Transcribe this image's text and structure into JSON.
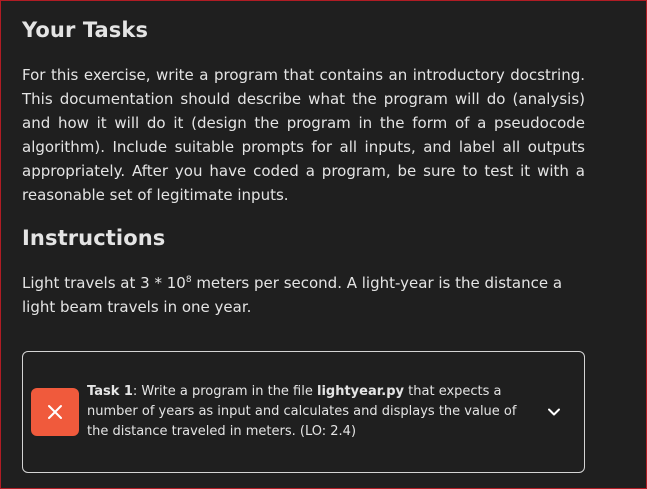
{
  "tasks_section": {
    "heading": "Your Tasks",
    "body": "For this exercise, write a program that contains an introductory docstring. This documentation should describe what the program will do (analysis) and how it will do it (design the program in the form of a pseudocode algorithm). Include suitable prompts for all inputs, and label all outputs appropriately. After you have coded a program, be sure to test it with a reasonable set of legitimate inputs."
  },
  "instructions_section": {
    "heading": "Instructions",
    "body_before": "Light travels at 3 * 10",
    "body_exponent": "8",
    "body_after": " meters per second. A light-year is the distance a light beam travels in one year."
  },
  "task_card": {
    "status_icon": "x-mark-icon",
    "status_color": "#f05a3c",
    "task_label": "Task 1",
    "text_before_file": ": Write a program in the file ",
    "file_name": "lightyear.py",
    "text_after_file": " that expects a number of years as input and calculates and displays the value of the distance traveled in meters. (LO: 2.4)",
    "expand_icon": "chevron-down-icon"
  }
}
